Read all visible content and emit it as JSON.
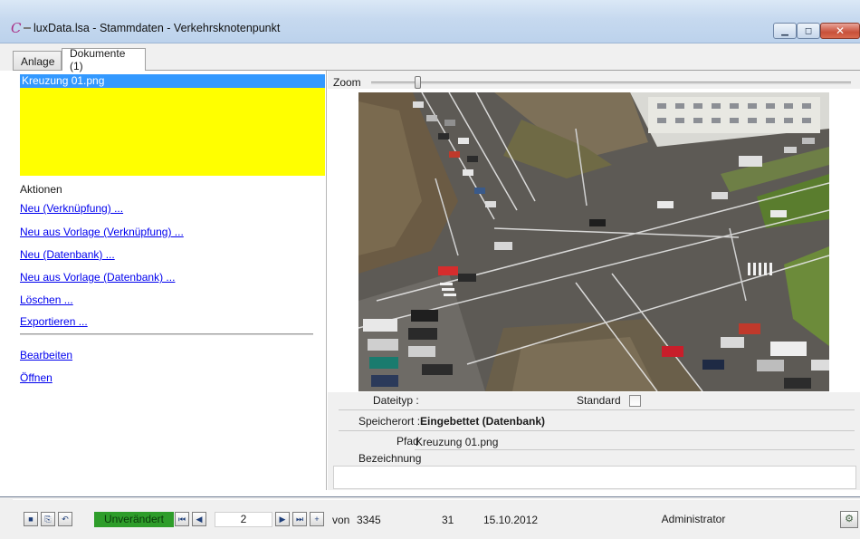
{
  "window": {
    "title": "luxData.lsa - Stammdaten - Verkehrsknotenpunkt",
    "minimize_symbol": "▁",
    "maximize_symbol": "◻",
    "close_symbol": "✕",
    "logo_icon": "luxdata-logo-icon"
  },
  "tabs": [
    {
      "label": "Anlage",
      "active": false
    },
    {
      "label": "Dokumente (1)",
      "active": true
    }
  ],
  "documents": {
    "items": [
      "Kreuzung 01.png"
    ],
    "selected_index": 0,
    "list_background": "#ffff00",
    "selection_color": "#3399ff"
  },
  "actions": {
    "title": "Aktionen",
    "links": [
      "Neu (Verknüpfung) ...",
      "Neu aus Vorlage (Verknüpfung) ...",
      "Neu (Datenbank) ...",
      "Neu aus Vorlage (Datenbank) ...",
      "Löschen ...",
      "Exportieren ..."
    ],
    "secondary_links": [
      "Bearbeiten",
      "Öffnen"
    ],
    "link_color": "#0000ee"
  },
  "viewer": {
    "zoom_label": "Zoom",
    "zoom_level": 0.1,
    "image_subject": "aerial-photo-road-intersection"
  },
  "details": {
    "dateityp_label": "Dateityp :",
    "dateityp_value": "",
    "standard_label": "Standard",
    "standard_checked": false,
    "speicherort_label": "Speicherort :",
    "speicherort_value": "Eingebettet (Datenbank)",
    "pfad_label": "Pfad",
    "pfad_value": "Kreuzung 01.png",
    "bezeichnung_label": "Bezeichnung",
    "bezeichnung_value": ""
  },
  "navigator": {
    "save_icon": "floppy-save-icon",
    "copy_icon": "copy-record-icon",
    "undo_icon": "undo-icon",
    "status": "Unverändert",
    "status_color": "#2e9d2a",
    "first_icon": "first-record-icon",
    "prev_icon": "previous-record-icon",
    "position": "2",
    "next_icon": "next-record-icon",
    "last_icon": "last-record-icon",
    "add_icon": "add-record-icon",
    "von_label": "von",
    "total": "3345",
    "field2": "31",
    "date": "15.10.2012",
    "user": "Administrator",
    "tool_icon": "settings-tool-icon"
  }
}
